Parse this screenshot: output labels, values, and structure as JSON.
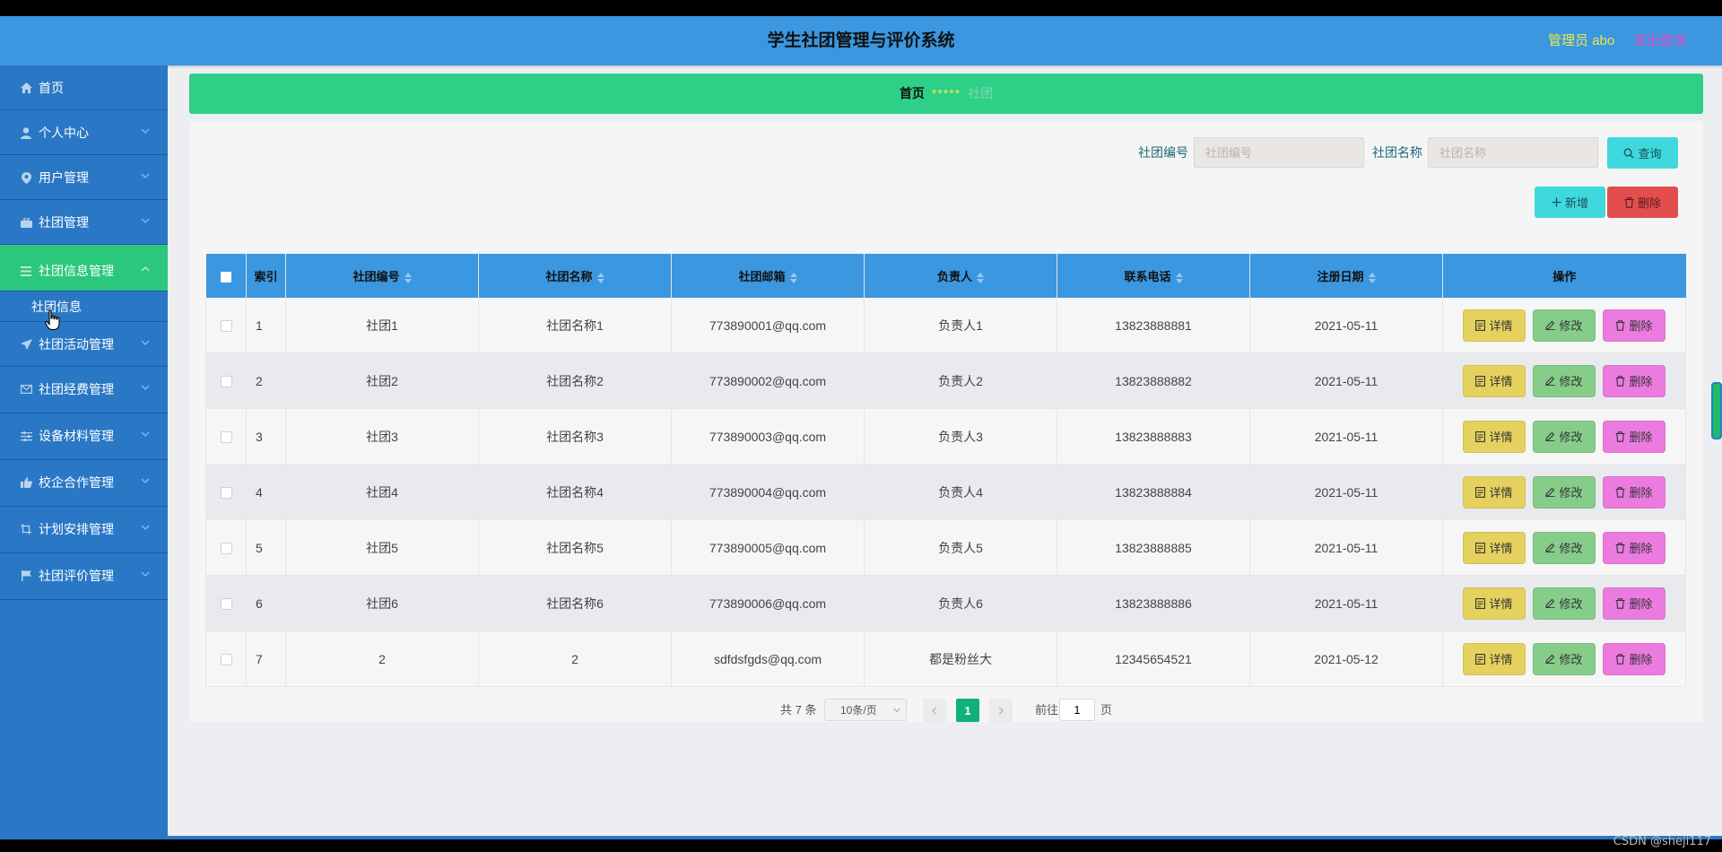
{
  "header": {
    "title": "学生社团管理与评价系统",
    "user": "管理员 abo",
    "logout": "退出登录"
  },
  "sidebar": {
    "items": [
      {
        "label": "首页",
        "icon": "home-icon"
      },
      {
        "label": "个人中心",
        "icon": "user-icon"
      },
      {
        "label": "用户管理",
        "icon": "location-pin-icon"
      },
      {
        "label": "社团管理",
        "icon": "briefcase-icon"
      },
      {
        "label": "社团信息管理",
        "icon": "list-icon"
      },
      {
        "label": "社团活动管理",
        "icon": "send-icon"
      },
      {
        "label": "社团经费管理",
        "icon": "mail-icon"
      },
      {
        "label": "设备材料管理",
        "icon": "sliders-icon"
      },
      {
        "label": "校企合作管理",
        "icon": "thumbs-up-icon"
      },
      {
        "label": "计划安排管理",
        "icon": "crop-icon"
      },
      {
        "label": "社团评价管理",
        "icon": "flag-icon"
      }
    ],
    "submenu": {
      "label": "社团信息"
    }
  },
  "breadcrumb": {
    "home": "首页",
    "separator": "*****",
    "current": "社团"
  },
  "search": {
    "field1_label": "社团编号",
    "field1_placeholder": "社团编号",
    "field2_label": "社团名称",
    "field2_placeholder": "社团名称",
    "query_button": "查询",
    "add_button": "新增",
    "delete_button": "删除"
  },
  "table": {
    "columns": [
      "索引",
      "社团编号",
      "社团名称",
      "社团邮箱",
      "负责人",
      "联系电话",
      "注册日期",
      "操作"
    ],
    "rows": [
      {
        "index": "1",
        "code": "社团1",
        "name": "社团名称1",
        "email": "773890001@qq.com",
        "leader": "负责人1",
        "phone": "13823888881",
        "date": "2021-05-11"
      },
      {
        "index": "2",
        "code": "社团2",
        "name": "社团名称2",
        "email": "773890002@qq.com",
        "leader": "负责人2",
        "phone": "13823888882",
        "date": "2021-05-11"
      },
      {
        "index": "3",
        "code": "社团3",
        "name": "社团名称3",
        "email": "773890003@qq.com",
        "leader": "负责人3",
        "phone": "13823888883",
        "date": "2021-05-11"
      },
      {
        "index": "4",
        "code": "社团4",
        "name": "社团名称4",
        "email": "773890004@qq.com",
        "leader": "负责人4",
        "phone": "13823888884",
        "date": "2021-05-11"
      },
      {
        "index": "5",
        "code": "社团5",
        "name": "社团名称5",
        "email": "773890005@qq.com",
        "leader": "负责人5",
        "phone": "13823888885",
        "date": "2021-05-11"
      },
      {
        "index": "6",
        "code": "社团6",
        "name": "社团名称6",
        "email": "773890006@qq.com",
        "leader": "负责人6",
        "phone": "13823888886",
        "date": "2021-05-11"
      },
      {
        "index": "7",
        "code": "2",
        "name": "2",
        "email": "sdfdsfgds@qq.com",
        "leader": "都是粉丝大",
        "phone": "12345654521",
        "date": "2021-05-12"
      }
    ],
    "actions": {
      "detail": "详情",
      "edit": "修改",
      "delete": "删除"
    }
  },
  "pagination": {
    "total": "共 7 条",
    "page_size": "10条/页",
    "current_page": "1",
    "goto_label": "前往",
    "goto_value": "1",
    "goto_suffix": "页"
  },
  "watermark": "CSDN @sheji117",
  "colors": {
    "header": "#3a97e0",
    "sidebar": "#2a78c5",
    "active_menu": "#2bc77d",
    "breadcrumb": "#2ecf87",
    "query_button": "#3ed8dd",
    "delete_button": "#e24e4e",
    "detail_button": "#e5d15e",
    "edit_button": "#86cd8a",
    "row_delete_button": "#ec7be0",
    "pager_active": "#10b07a"
  }
}
